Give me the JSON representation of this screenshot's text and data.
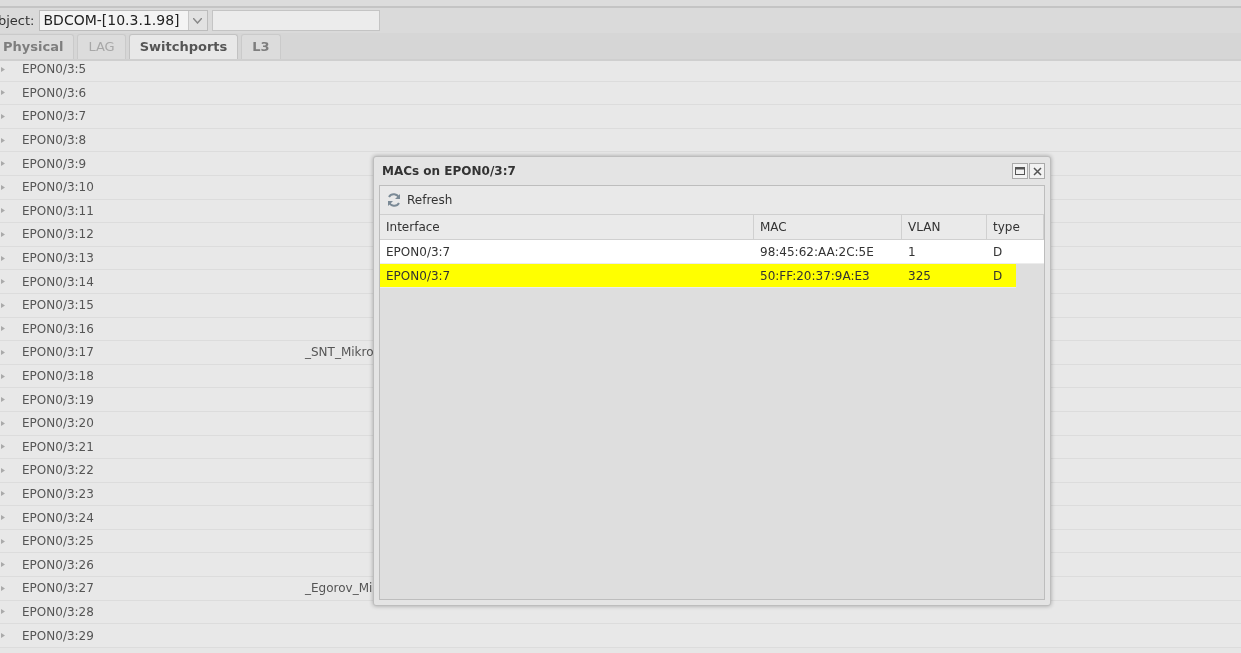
{
  "toolbar": {
    "object_label": "bject:",
    "object_value": "BDCOM-[10.3.1.98]"
  },
  "tabs": [
    {
      "label": "Physical",
      "selected": false,
      "disabled": false
    },
    {
      "label": "LAG",
      "selected": false,
      "disabled": true
    },
    {
      "label": "Switchports",
      "selected": true,
      "disabled": false
    },
    {
      "label": "L3",
      "selected": false,
      "disabled": false
    }
  ],
  "ports": [
    {
      "name": "EPON0/3:5"
    },
    {
      "name": "EPON0/3:6"
    },
    {
      "name": "EPON0/3:7"
    },
    {
      "name": "EPON0/3:8"
    },
    {
      "name": "EPON0/3:9"
    },
    {
      "name": "EPON0/3:10"
    },
    {
      "name": "EPON0/3:11"
    },
    {
      "name": "EPON0/3:12"
    },
    {
      "name": "EPON0/3:13"
    },
    {
      "name": "EPON0/3:14"
    },
    {
      "name": "EPON0/3:15"
    },
    {
      "name": "EPON0/3:16"
    },
    {
      "name": "EPON0/3:17",
      "description": "_SNT_Mikro"
    },
    {
      "name": "EPON0/3:18"
    },
    {
      "name": "EPON0/3:19"
    },
    {
      "name": "EPON0/3:20"
    },
    {
      "name": "EPON0/3:21"
    },
    {
      "name": "EPON0/3:22"
    },
    {
      "name": "EPON0/3:23"
    },
    {
      "name": "EPON0/3:24"
    },
    {
      "name": "EPON0/3:25"
    },
    {
      "name": "EPON0/3:26"
    },
    {
      "name": "EPON0/3:27",
      "description": "_Egorov_Mi"
    },
    {
      "name": "EPON0/3:28"
    },
    {
      "name": "EPON0/3:29"
    }
  ],
  "dialog": {
    "title": "MACs on EPON0/3:7",
    "refresh_label": "Refresh",
    "columns": [
      "Interface",
      "MAC",
      "VLAN",
      "type"
    ],
    "rows": [
      {
        "cells": [
          "EPON0/3:7",
          "98:45:62:AA:2C:5E",
          "1",
          "D"
        ],
        "highlighted": false
      },
      {
        "cells": [
          "EPON0/3:7",
          "50:FF:20:37:9A:E3",
          "325",
          "D"
        ],
        "highlighted": true
      }
    ]
  }
}
